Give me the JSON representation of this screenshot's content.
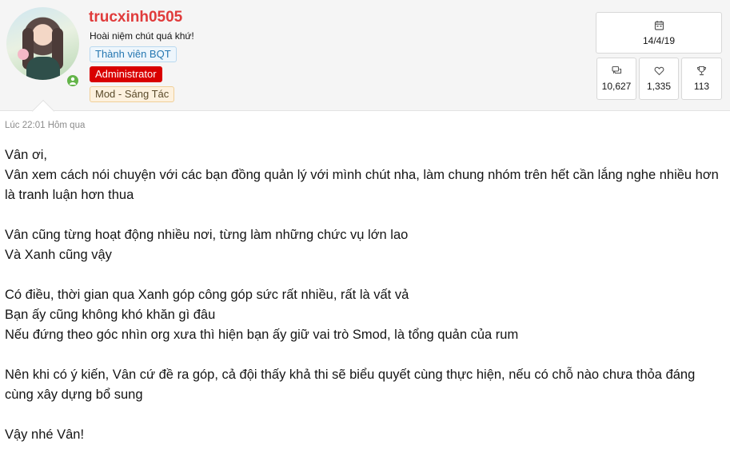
{
  "user": {
    "name": "trucxinh0505",
    "title": "Hoài niệm chút quá khứ!",
    "banners": [
      "Thành viên BQT",
      "Administrator",
      "Mod - Sáng Tác"
    ]
  },
  "stats": {
    "joined": "14/4/19",
    "messages": "10,627",
    "reactions": "1,335",
    "points": "113"
  },
  "post": {
    "timestamp": "Lúc 22:01 Hôm qua",
    "lines": [
      "Vân ơi,",
      "Vân xem cách nói chuyện với các bạn đồng quản lý với mình chút nha, làm chung nhóm trên hết cần lắng nghe nhiều hơn là tranh luận hơn thua",
      "",
      "Vân cũng từng hoạt động nhiều nơi, từng làm những chức vụ lớn lao",
      "Và Xanh cũng vậy",
      "",
      "Có điều, thời gian qua Xanh góp công góp sức rất nhiều, rất là vất vả",
      "Bạn ấy cũng không khó khăn gì đâu",
      "Nếu đứng theo góc nhìn org xưa thì hiện bạn ấy giữ vai trò Smod, là tổng quản của rum",
      "",
      "Nên khi có ý kiến, Vân cứ đề ra góp, cả đội thấy khả thi sẽ biểu quyết cùng thực hiện, nếu có chỗ nào chưa thỏa đáng cùng xây dựng bổ sung",
      "",
      "Vậy nhé Vân!"
    ]
  },
  "colors": {
    "username": "#e03b3b",
    "online": "#63b449",
    "admin_banner": "#d90000"
  }
}
